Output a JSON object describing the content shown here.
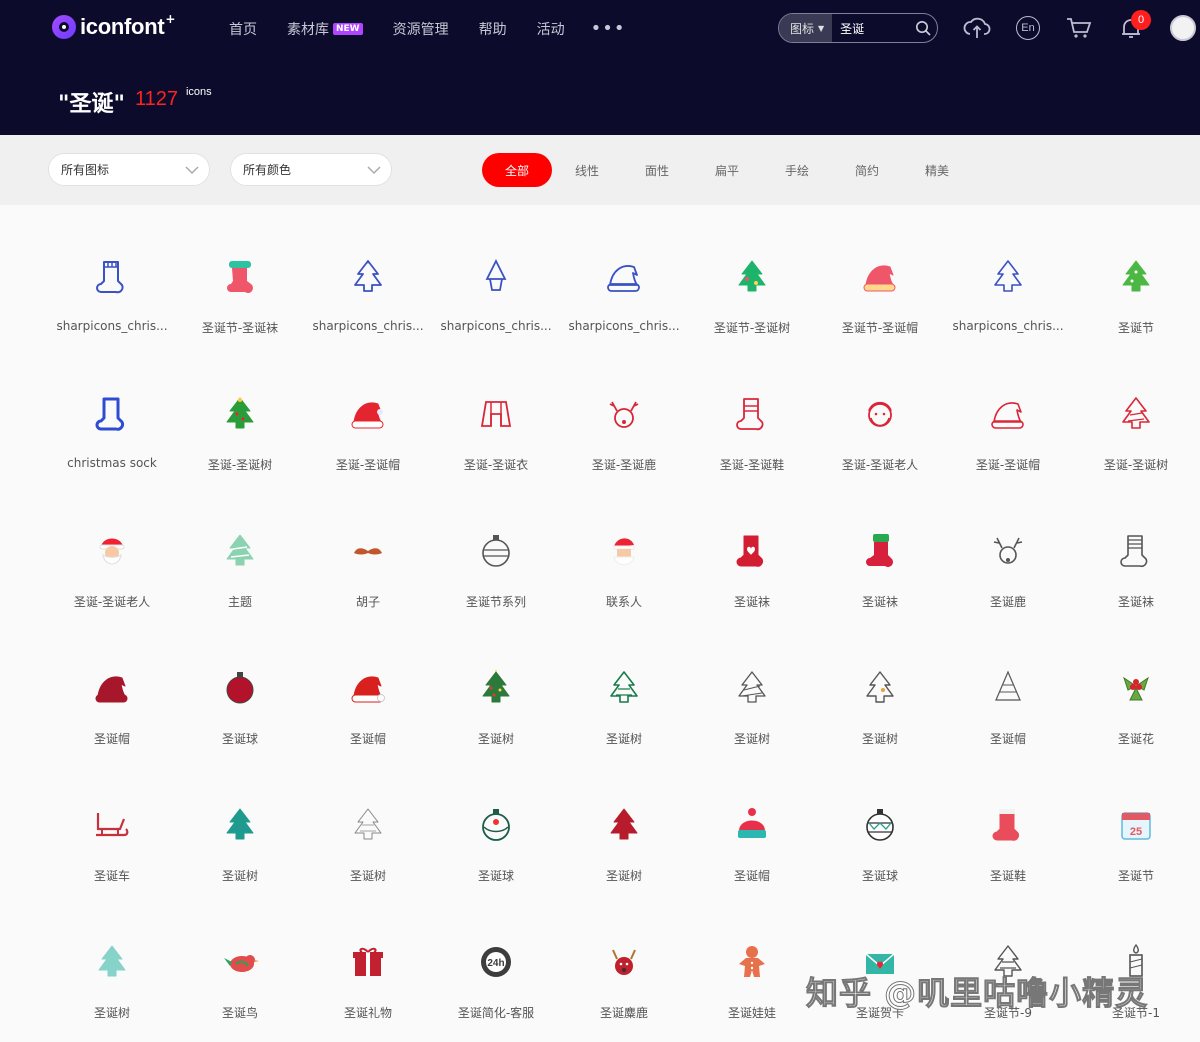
{
  "header": {
    "logo_text": "iconfont",
    "logo_plus": "+",
    "nav": [
      {
        "label": "首页"
      },
      {
        "label": "素材库",
        "badge": "NEW"
      },
      {
        "label": "资源管理"
      },
      {
        "label": "帮助"
      },
      {
        "label": "活动"
      }
    ],
    "more_label": "•••",
    "search": {
      "type": "图标",
      "value": "圣诞"
    },
    "language": "En",
    "notification_count": "0"
  },
  "title": {
    "query": "\"圣诞\"",
    "count": "1127",
    "unit": "icons"
  },
  "filters": {
    "icon_dropdown": "所有图标",
    "color_dropdown": "所有颜色",
    "tabs": [
      "全部",
      "线性",
      "面性",
      "扁平",
      "手绘",
      "简约",
      "精美"
    ],
    "active_tab": "全部"
  },
  "icons": [
    {
      "label": "sharpicons_chris...",
      "icon": "sock-outline-icon"
    },
    {
      "label": "圣诞节-圣诞袜",
      "icon": "sock-color-icon"
    },
    {
      "label": "sharpicons_chris...",
      "icon": "tree-star-outline-icon"
    },
    {
      "label": "sharpicons_chris...",
      "icon": "tree-pot-outline-icon"
    },
    {
      "label": "sharpicons_chris...",
      "icon": "hat-outline-icon"
    },
    {
      "label": "圣诞节-圣诞树",
      "icon": "tree-color-icon"
    },
    {
      "label": "圣诞节-圣诞帽",
      "icon": "hat-color-icon"
    },
    {
      "label": "sharpicons_chris...",
      "icon": "tree-outline-icon"
    },
    {
      "label": "圣诞节",
      "icon": "tree-green-icon"
    },
    {
      "label": "christmas sock",
      "icon": "sock-blue-icon"
    },
    {
      "label": "圣诞-圣诞树",
      "icon": "tree-small-icon"
    },
    {
      "label": "圣诞-圣诞帽",
      "icon": "hat-red-icon"
    },
    {
      "label": "圣诞-圣诞衣",
      "icon": "coat-line-icon"
    },
    {
      "label": "圣诞-圣诞鹿",
      "icon": "deer-line-icon"
    },
    {
      "label": "圣诞-圣诞鞋",
      "icon": "shoe-line-icon"
    },
    {
      "label": "圣诞-圣诞老人",
      "icon": "santa-line-icon"
    },
    {
      "label": "圣诞-圣诞帽",
      "icon": "hat-line-icon"
    },
    {
      "label": "圣诞-圣诞树",
      "icon": "tree-line-red-icon"
    },
    {
      "label": "圣诞-圣诞老人",
      "icon": "santa-face-icon"
    },
    {
      "label": "主题",
      "icon": "tree-light-icon"
    },
    {
      "label": "胡子",
      "icon": "mustache-icon"
    },
    {
      "label": "圣诞节系列",
      "icon": "ornament-outline-icon"
    },
    {
      "label": "联系人",
      "icon": "santa-portrait-icon"
    },
    {
      "label": "圣诞袜",
      "icon": "sock-heart-icon"
    },
    {
      "label": "圣诞袜",
      "icon": "sock-green-icon"
    },
    {
      "label": "圣诞鹿",
      "icon": "deer-outline-icon"
    },
    {
      "label": "圣诞袜",
      "icon": "sock-striped-icon"
    },
    {
      "label": "圣诞帽",
      "icon": "hat-dark-red-icon"
    },
    {
      "label": "圣诞球",
      "icon": "ball-red-icon"
    },
    {
      "label": "圣诞帽",
      "icon": "hat-big-icon"
    },
    {
      "label": "圣诞树",
      "icon": "tree-decorated-icon"
    },
    {
      "label": "圣诞树",
      "icon": "tree-green-line-icon"
    },
    {
      "label": "圣诞树",
      "icon": "tree-sketch-icon"
    },
    {
      "label": "圣诞树",
      "icon": "tree-dark-line-icon"
    },
    {
      "label": "圣诞帽",
      "icon": "hat-sketch-icon"
    },
    {
      "label": "圣诞花",
      "icon": "holly-icon"
    },
    {
      "label": "圣诞车",
      "icon": "sleigh-icon"
    },
    {
      "label": "圣诞树",
      "icon": "tree-teal-icon"
    },
    {
      "label": "圣诞树",
      "icon": "tree-thin-icon"
    },
    {
      "label": "圣诞球",
      "icon": "ball-snowman-icon"
    },
    {
      "label": "圣诞树",
      "icon": "tree-red-icon"
    },
    {
      "label": "圣诞帽",
      "icon": "beanie-icon"
    },
    {
      "label": "圣诞球",
      "icon": "ball-pattern-icon"
    },
    {
      "label": "圣诞鞋",
      "icon": "boot-red-icon"
    },
    {
      "label": "圣诞节",
      "icon": "calendar-25-icon"
    },
    {
      "label": "圣诞树",
      "icon": "tree-mint-icon"
    },
    {
      "label": "圣诞鸟",
      "icon": "bird-icon"
    },
    {
      "label": "圣诞礼物",
      "icon": "gift-icon"
    },
    {
      "label": "圣诞简化-客服",
      "icon": "24h-service-icon"
    },
    {
      "label": "圣诞麋鹿",
      "icon": "reindeer-red-icon"
    },
    {
      "label": "圣诞娃娃",
      "icon": "gingerbread-icon"
    },
    {
      "label": "圣诞贺卡",
      "icon": "greeting-card-icon"
    },
    {
      "label": "圣诞节-9",
      "icon": "tree-bell-icon"
    },
    {
      "label": "圣诞节-1",
      "icon": "candle-icon"
    }
  ],
  "watermark": "知乎 @叽里咕噜小精灵",
  "colors": {
    "header_bg": "#0d0b2b",
    "accent": "#ff0000",
    "count": "#ff2222"
  }
}
